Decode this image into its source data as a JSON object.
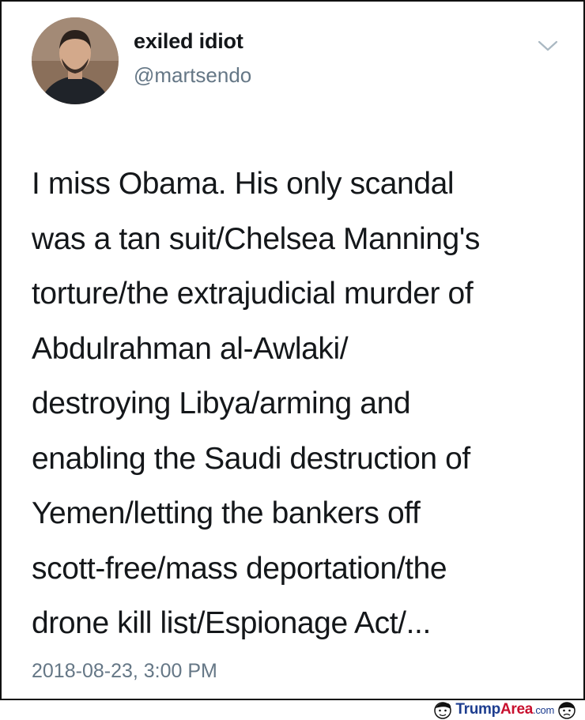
{
  "user": {
    "display_name": "exiled idiot",
    "handle": "@martsendo"
  },
  "tweet": {
    "lines": [
      "I miss Obama. His only scandal",
      "was a tan suit/Chelsea Manning's",
      "torture/the extrajudicial murder of",
      "Abdulrahman al-Awlaki/",
      "destroying Libya/arming and",
      "enabling the Saudi destruction of",
      "Yemen/letting the bankers off",
      "scott-free/mass deportation/the",
      "drone kill list/Espionage Act/..."
    ],
    "timestamp": "2018-08-23, 3:00 PM"
  },
  "watermark": {
    "part1": "Trump",
    "part2": "Area",
    "part3": ".com"
  },
  "colors": {
    "text": "#14171a",
    "secondary": "#657786",
    "watermark_blue": "#1d3d8f",
    "watermark_red": "#c8102e"
  },
  "icons": [
    "avatar",
    "chevron-down-icon",
    "cartoon-face-icon"
  ]
}
